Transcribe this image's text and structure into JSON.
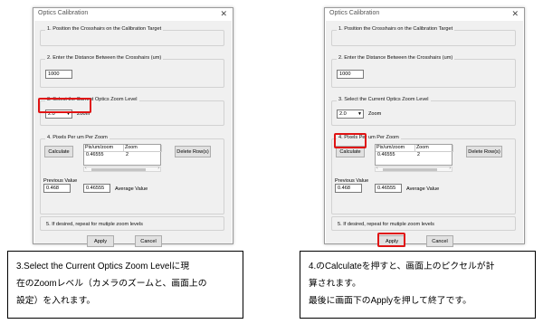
{
  "dialog": {
    "title": "Optics Calibration",
    "close_glyph": "✕",
    "section1_title": "1.  Position the Crosshairs on the Calibration Target",
    "section2_title": "2.  Enter the Distance Between the Crosshairs (um)",
    "distance_value": "1000",
    "section3_title": "3.  Select the Current Optics Zoom Level",
    "zoom_value": "2.0",
    "zoom_dropdown_arrow": "▼",
    "zoom_label": "Zoom",
    "section4_title": "4.  Pixels Per um Per Zoom",
    "calculate_label": "Calculate",
    "delete_label": "Delete Row(s)",
    "grid_headers": [
      "Pix/um/zoom",
      "Zoom"
    ],
    "grid_row": [
      "0.46555",
      "2"
    ],
    "scroll_left": "‹",
    "scroll_right": "›",
    "previous_value_label": "Previous Value",
    "previous_value": "0.468",
    "average_value": "0.46555",
    "average_value_label": "Average Value",
    "section5_title": "5.  If desired, repeat for mutiple zoom levels",
    "apply_label": "Apply",
    "cancel_label": "Cancel"
  },
  "notes": {
    "left": {
      "line1": "3.Select the Current Optics Zoom Levelに現",
      "line2": "在のZoomレベル（カメラのズームと、画面上の",
      "line3": "設定）を入れます。"
    },
    "right": {
      "line1": "4.のCalculateを押すと、画面上のピクセルが計",
      "line2": "算されます。",
      "line3": "最後に画面下のApplyを押して終了です。"
    }
  },
  "colors": {
    "highlight": "#e01414",
    "dialog_background": "#f0f0f0",
    "button_face": "#e1e1e1"
  }
}
